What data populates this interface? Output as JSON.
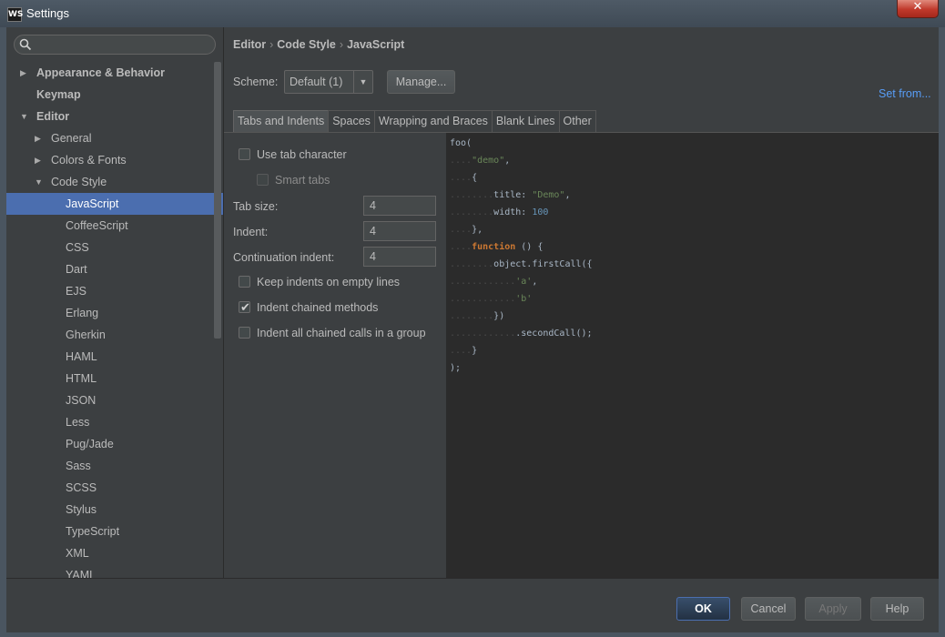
{
  "window": {
    "title": "Settings",
    "app_badge": "WS",
    "close_label": "✕"
  },
  "sidebar": {
    "search_placeholder": "",
    "items": [
      {
        "label": "Appearance & Behavior",
        "arrow": "▶"
      },
      {
        "label": "Keymap"
      },
      {
        "label": "Editor",
        "arrow": "▼"
      },
      {
        "label": "General",
        "arrow": "▶"
      },
      {
        "label": "Colors & Fonts",
        "arrow": "▶"
      },
      {
        "label": "Code Style",
        "arrow": "▼"
      },
      {
        "label": "JavaScript",
        "selected": true
      },
      {
        "label": "CoffeeScript"
      },
      {
        "label": "CSS"
      },
      {
        "label": "Dart"
      },
      {
        "label": "EJS"
      },
      {
        "label": "Erlang"
      },
      {
        "label": "Gherkin"
      },
      {
        "label": "HAML"
      },
      {
        "label": "HTML"
      },
      {
        "label": "JSON"
      },
      {
        "label": "Less"
      },
      {
        "label": "Pug/Jade"
      },
      {
        "label": "Sass"
      },
      {
        "label": "SCSS"
      },
      {
        "label": "Stylus"
      },
      {
        "label": "TypeScript"
      },
      {
        "label": "XML"
      },
      {
        "label": "YAML"
      }
    ]
  },
  "breadcrumb": {
    "a": "Editor",
    "b": "Code Style",
    "c": "JavaScript",
    "sep": "›"
  },
  "scheme": {
    "label": "Scheme:",
    "value": "Default (1)",
    "manage_label": "Manage...",
    "set_from_label": "Set from..."
  },
  "tabs": [
    "Tabs and Indents",
    "Spaces",
    "Wrapping and Braces",
    "Blank Lines",
    "Other"
  ],
  "options": {
    "use_tab_character": {
      "label": "Use tab character",
      "checked": false
    },
    "smart_tabs": {
      "label": "Smart tabs",
      "checked": false
    },
    "tab_size": {
      "label": "Tab size:",
      "value": "4"
    },
    "indent": {
      "label": "Indent:",
      "value": "4"
    },
    "continuation_indent": {
      "label": "Continuation indent:",
      "value": "4"
    },
    "keep_indents": {
      "label": "Keep indents on empty lines",
      "checked": false
    },
    "indent_chained": {
      "label": "Indent chained methods",
      "checked": true
    },
    "indent_all_chained": {
      "label": "Indent all chained calls in a group",
      "checked": false
    }
  },
  "footer": {
    "ok_label": "OK",
    "cancel_label": "Cancel",
    "apply_label": "Apply",
    "help_label": "Help"
  }
}
